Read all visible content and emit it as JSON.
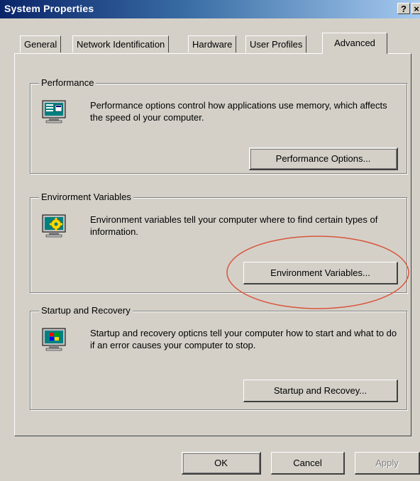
{
  "window": {
    "title": "System Properties",
    "help_label": "?",
    "close_label": "×"
  },
  "tabs": [
    {
      "label": "General",
      "active": false
    },
    {
      "label": "Network Identification",
      "active": false
    },
    {
      "label": "Hardware",
      "active": false
    },
    {
      "label": "User Profiles",
      "active": false
    },
    {
      "label": "Advanced",
      "active": true
    }
  ],
  "groups": {
    "performance": {
      "title": "Performance",
      "description": "Performance options control how applications use memory, which affects the speed ol your computer.",
      "button_label": "Performance Options...",
      "icon": "performance-monitor-icon"
    },
    "environment": {
      "title": "Envirorment Variables",
      "description": "Environment variables tell your computer where to find certain types of information.",
      "button_label": "Environment Variables...",
      "icon": "environment-settings-icon"
    },
    "startup": {
      "title": "Startup and Recovery",
      "description": "Startup and recovery opticns tell your computer how to start and what to do if an error causes your computer to stop.",
      "button_label": "Startup and Recovey...",
      "icon": "startup-monitor-icon"
    }
  },
  "footer": {
    "ok_label": "OK",
    "cancel_label": "Cancel",
    "apply_label": "Apply"
  },
  "colors": {
    "dialog_bg": "#d4d0c8",
    "title_start": "#0a246a",
    "title_end": "#a6caf0",
    "annotation": "#d9553c"
  }
}
